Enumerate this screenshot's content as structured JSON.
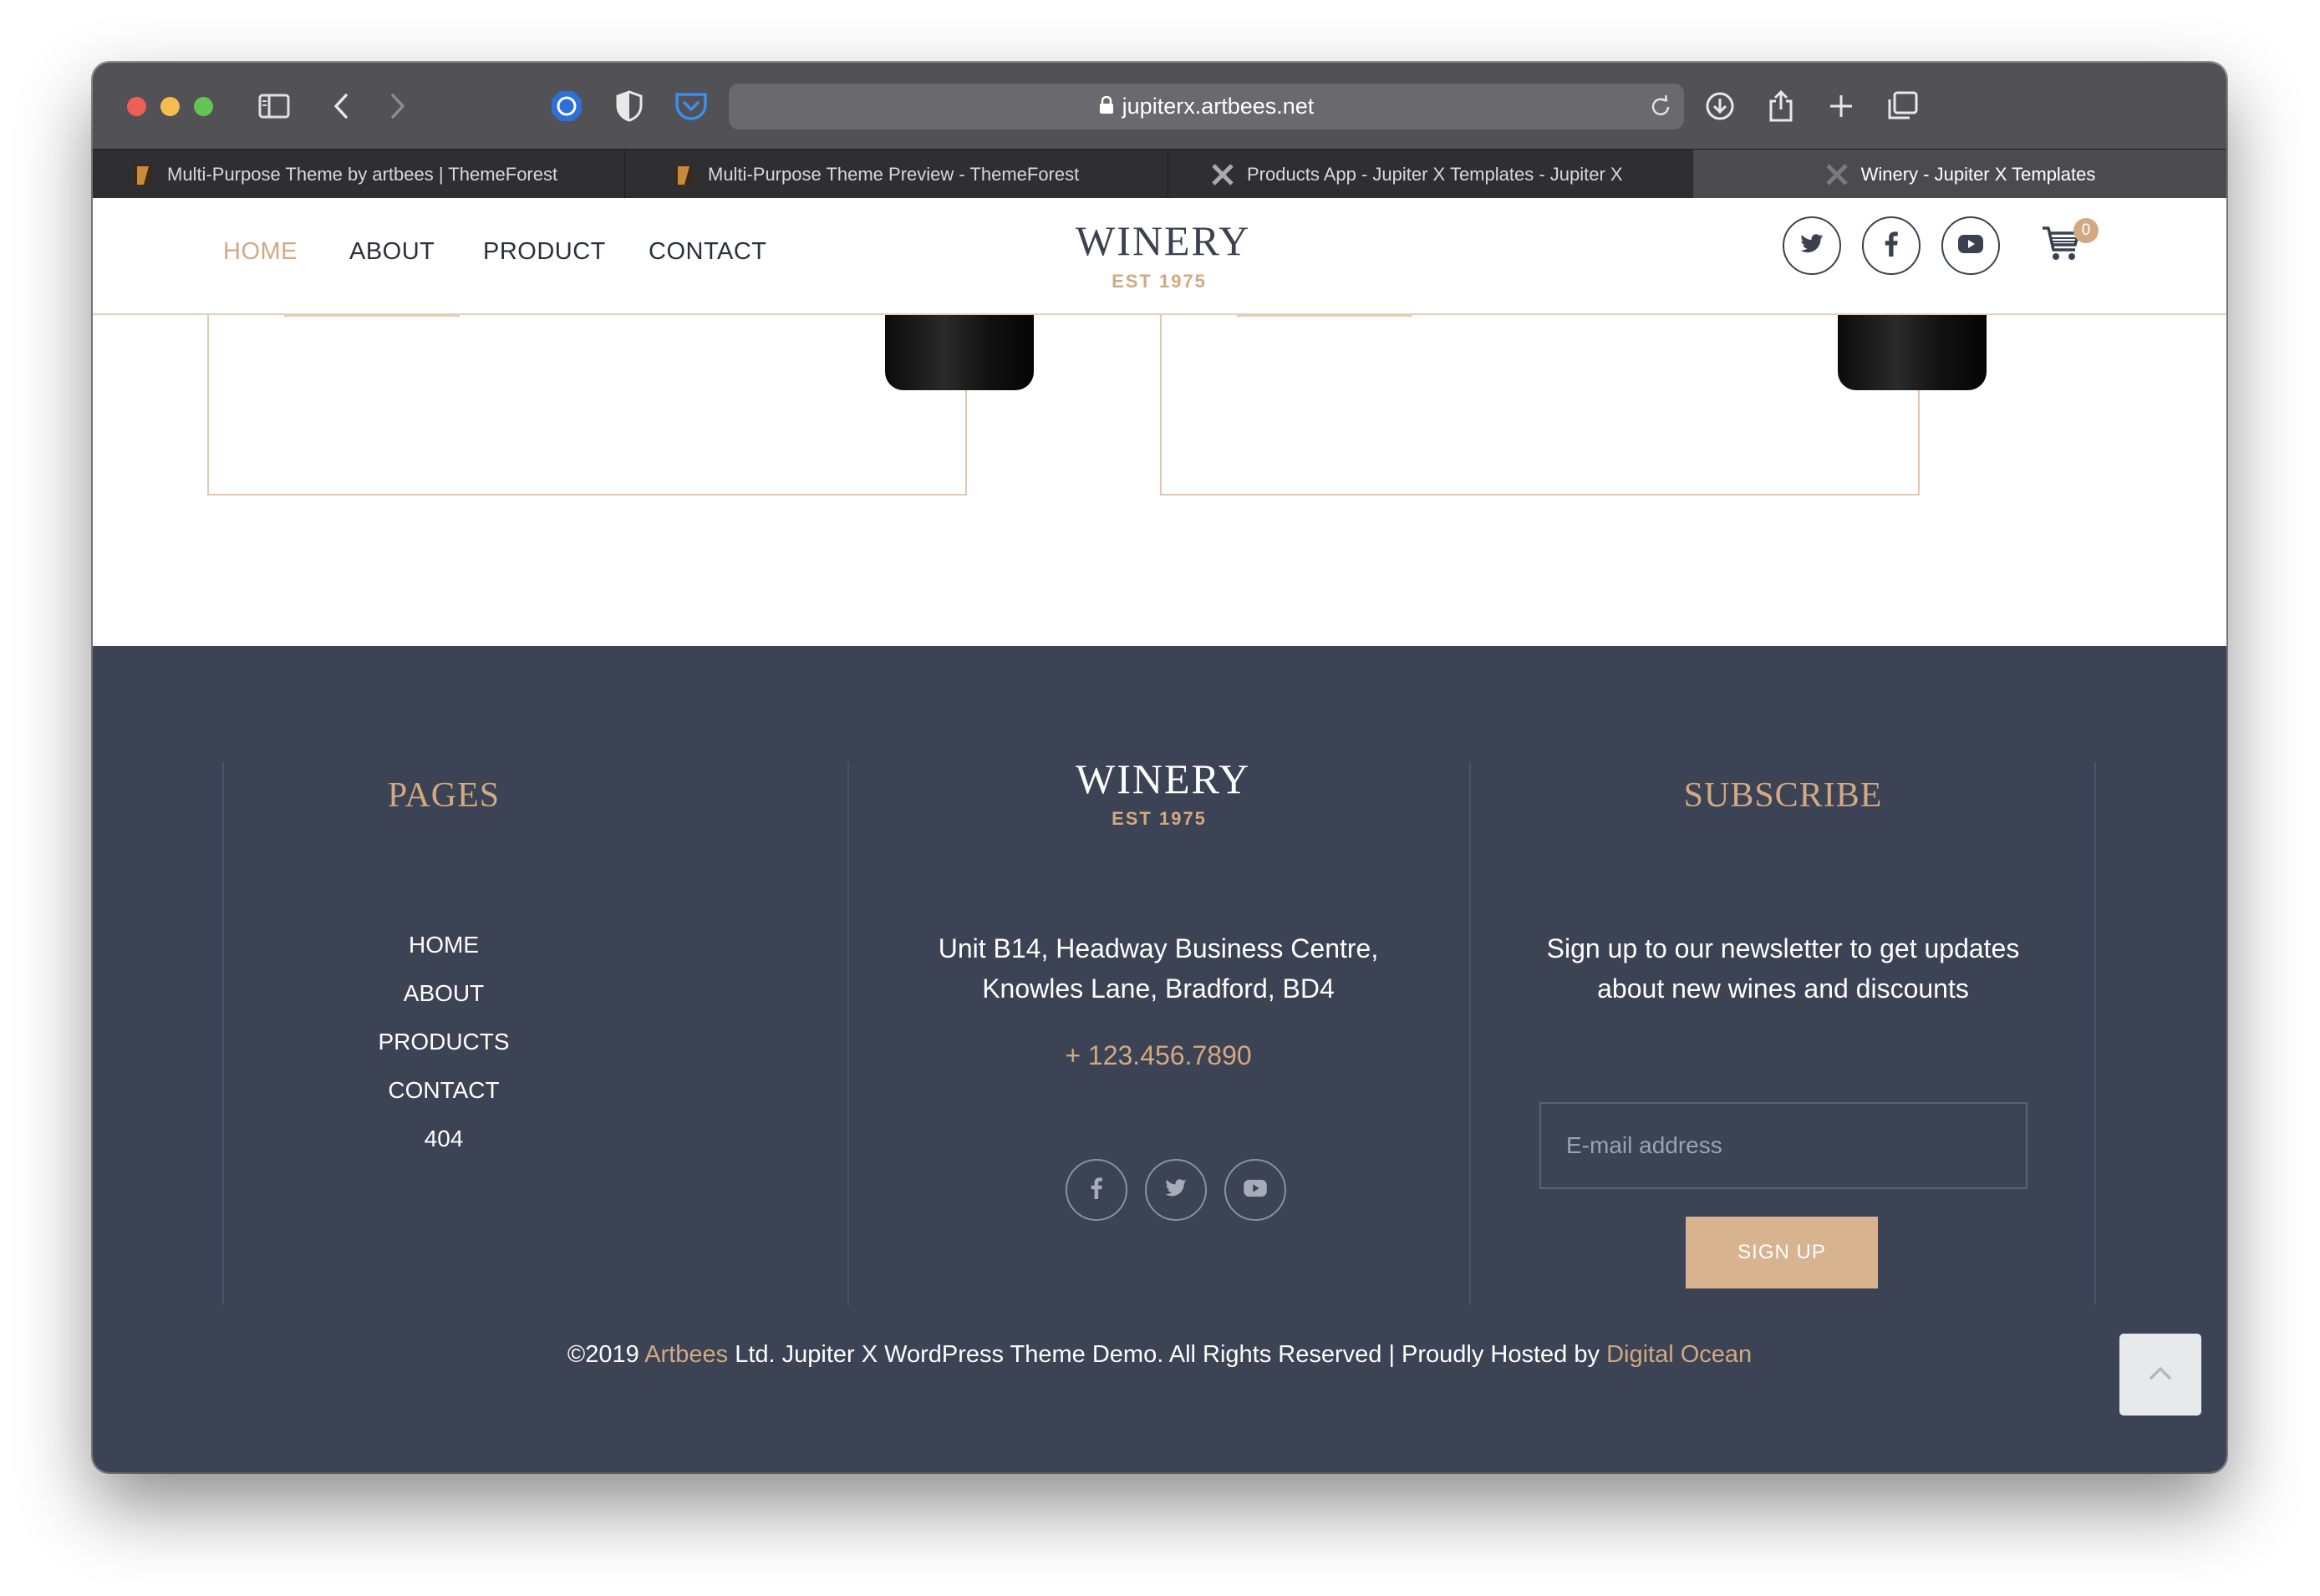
{
  "browser": {
    "url": "jupiterx.artbees.net",
    "tabs": [
      {
        "title": "Multi-Purpose Theme by artbees | ThemeForest"
      },
      {
        "title": "Multi-Purpose Theme Preview - ThemeForest"
      },
      {
        "title": "Products App - Jupiter X Templates - Jupiter X"
      },
      {
        "title": "Winery - Jupiter X Templates"
      }
    ]
  },
  "header": {
    "nav": [
      "HOME",
      "ABOUT",
      "PRODUCT",
      "CONTACT"
    ],
    "logo": {
      "name": "WINERY",
      "est": "EST 1975"
    },
    "cart_count": "0"
  },
  "footer": {
    "pages": {
      "title": "PAGES",
      "links": [
        "HOME",
        "ABOUT",
        "PRODUCTS",
        "CONTACT",
        "404"
      ]
    },
    "center": {
      "logo": {
        "name": "WINERY",
        "est": "EST 1975"
      },
      "address_line1": "Unit B14, Headway Business Centre,",
      "address_line2": "Knowles Lane, Bradford, BD4",
      "phone": "+ 123.456.7890"
    },
    "subscribe": {
      "title": "SUBSCRIBE",
      "text_line1": "Sign up to our newsletter to get updates",
      "text_line2": "about new wines and discounts",
      "email_placeholder": "E-mail address",
      "button": "SIGN UP"
    },
    "copyright": {
      "prefix": "©2019 ",
      "brand": "Artbees",
      "middle": " Ltd. Jupiter X WordPress Theme Demo. All Rights Reserved | Proudly Hosted by ",
      "host": "Digital Ocean"
    }
  },
  "colors": {
    "accent": "#d2a982",
    "footer_bg": "#3b4354",
    "nav_text": "#2b2f3b"
  }
}
